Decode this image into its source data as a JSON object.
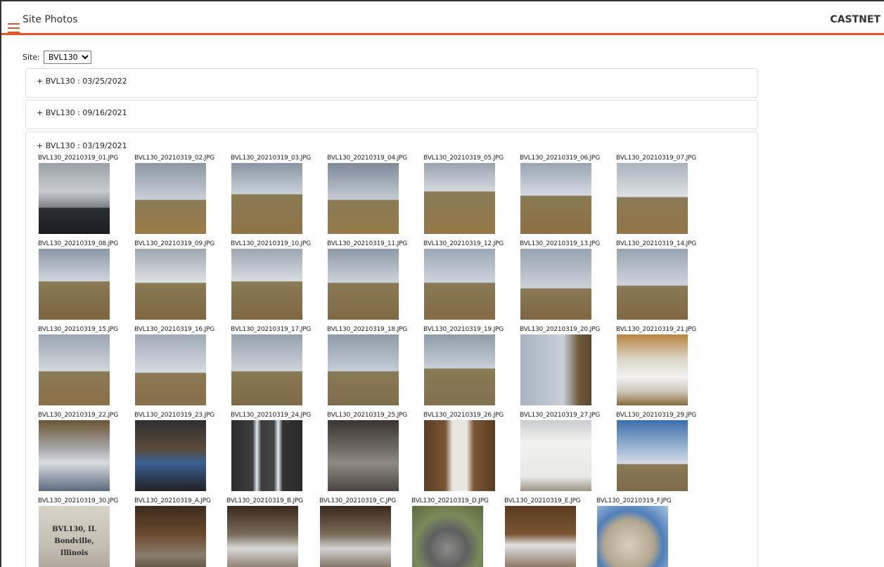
{
  "header": {
    "title": "Site Photos",
    "brand": "CASTNET"
  },
  "site": {
    "label": "Site:",
    "selected": "BVL130"
  },
  "panels": [
    {
      "label": "+ BVL130 : 03/25/2022"
    },
    {
      "label": "+ BVL130 : 09/16/2021"
    },
    {
      "label": "+ BVL130 : 03/19/2021"
    }
  ],
  "photos": [
    "BVL130_20210319_01.JPG",
    "BVL130_20210319_02.JPG",
    "BVL130_20210319_03.JPG",
    "BVL130_20210319_04.JPG",
    "BVL130_20210319_05.JPG",
    "BVL130_20210319_06.JPG",
    "BVL130_20210319_07.JPG",
    "BVL130_20210319_08.JPG",
    "BVL130_20210319_09.JPG",
    "BVL130_20210319_10.JPG",
    "BVL130_20210319_11.JPG",
    "BVL130_20210319_12.JPG",
    "BVL130_20210319_13.JPG",
    "BVL130_20210319_14.JPG",
    "BVL130_20210319_15.JPG",
    "BVL130_20210319_16.JPG",
    "BVL130_20210319_17.JPG",
    "BVL130_20210319_18.JPG",
    "BVL130_20210319_19.JPG",
    "BVL130_20210319_20.JPG",
    "BVL130_20210319_21.JPG",
    "BVL130_20210319_22.JPG",
    "BVL130_20210319_23.JPG",
    "BVL130_20210319_24.JPG",
    "BVL130_20210319_25.JPG",
    "BVL130_20210319_26.JPG",
    "BVL130_20210319_27.JPG",
    "BVL130_20210319_29.JPG",
    "BVL130_20210319_30.JPG",
    "BVL130_20210319_A.JPG",
    "BVL130_20210319_B.JPG",
    "BVL130_20210319_C.JPG",
    "BVL130_20210319_D.JPG",
    "BVL130_20210319_E.JPG",
    "BVL130_20210319_F.JPG"
  ],
  "sign_text": [
    "BVL130, IL",
    "Bondville,",
    "Illinois"
  ]
}
